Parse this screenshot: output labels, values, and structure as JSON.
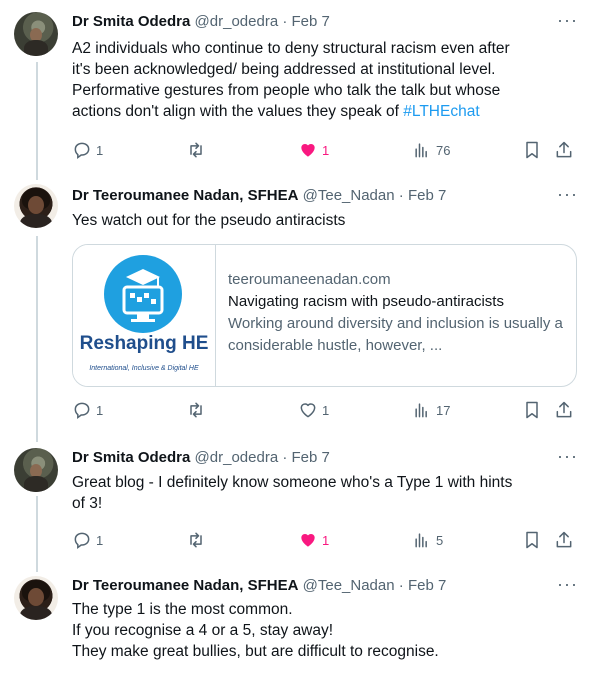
{
  "tweets": [
    {
      "author": "Dr Smita Odedra",
      "handle": "@dr_odedra",
      "date": "Feb 7",
      "text_lines": [
        "A2 individuals who continue to deny structural racism even after",
        "it's been acknowledged/ being addressed at institutional level.",
        "Performative gestures from people who talk the talk but whose"
      ],
      "text_last": "actions don't align with the values they speak of ",
      "hashtag": "#LTHEchat",
      "replies": "1",
      "likes": "1",
      "liked": true,
      "views": "76"
    },
    {
      "author": "Dr Teeroumanee Nadan, SFHEA",
      "handle": "@Tee_Nadan",
      "date": "Feb 7",
      "text_lines": [
        "Yes watch out for the pseudo antiracists"
      ],
      "card": {
        "logo_title": "Reshaping HE",
        "logo_tagline": "International, Inclusive & Digital HE",
        "domain": "teeroumaneenadan.com",
        "title": "Navigating racism with pseudo-antiracists",
        "description": "Working around diversity and inclusion is usually a considerable hustle, however, ..."
      },
      "replies": "1",
      "likes": "1",
      "liked": false,
      "views": "17"
    },
    {
      "author": "Dr Smita Odedra",
      "handle": "@dr_odedra",
      "date": "Feb 7",
      "text_lines": [
        "Great blog - I definitely know someone who's a Type 1 with hints",
        "of 3!"
      ],
      "replies": "1",
      "likes": "1",
      "liked": true,
      "views": "5"
    },
    {
      "author": "Dr Teeroumanee Nadan, SFHEA",
      "handle": "@Tee_Nadan",
      "date": "Feb 7",
      "text_lines": [
        "The type 1 is the most common.",
        "If you recognise a 4 or a 5, stay away!",
        "They make great bullies, but are difficult to recognise."
      ]
    }
  ],
  "separator": "·",
  "more_glyph": "···",
  "colors": {
    "like_active": "#f91880",
    "link": "#1d9bf0",
    "secondary": "#536471",
    "thread_line": "#cfd9de"
  }
}
